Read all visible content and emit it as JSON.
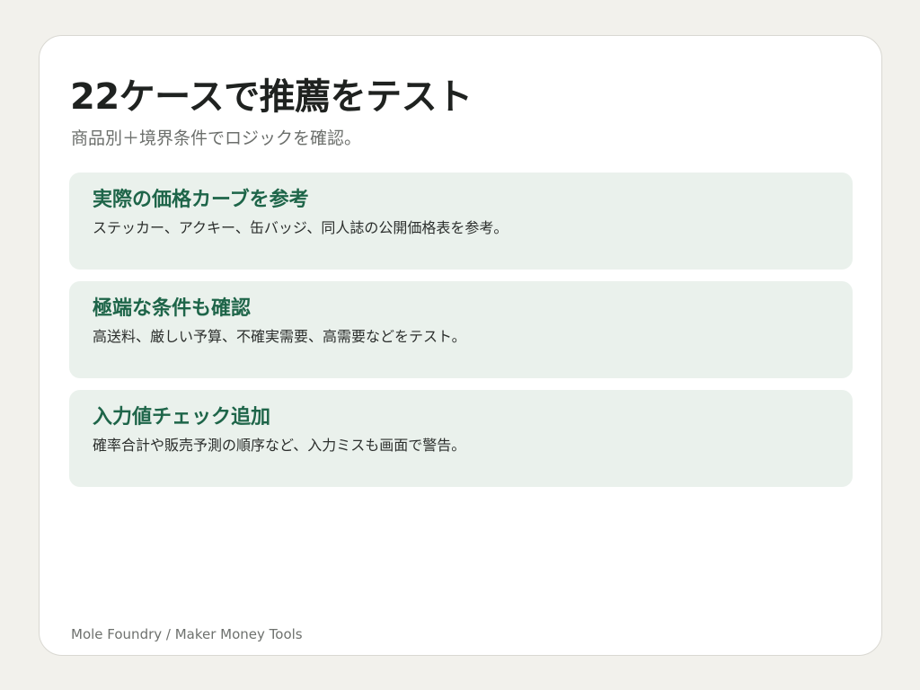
{
  "header": {
    "title": "22ケースで推薦をテスト",
    "subtitle": "商品別＋境界条件でロジックを確認。"
  },
  "features": [
    {
      "title": "実際の価格カーブを参考",
      "description": "ステッカー、アクキー、缶バッジ、同人誌の公開価格表を参考。"
    },
    {
      "title": "極端な条件も確認",
      "description": "高送料、厳しい予算、不確実需要、高需要などをテスト。"
    },
    {
      "title": "入力値チェック追加",
      "description": "確率合計や販売予測の順序など、入力ミスも画面で警告。"
    }
  ],
  "footer": {
    "credit": "Mole Foundry / Maker Money Tools"
  },
  "colors": {
    "background": "#f2f1ec",
    "card": "#ffffff",
    "feature_background": "#eaf1ec",
    "feature_title": "#1e6549",
    "title": "#1f2220",
    "muted": "#6c6f6c"
  }
}
